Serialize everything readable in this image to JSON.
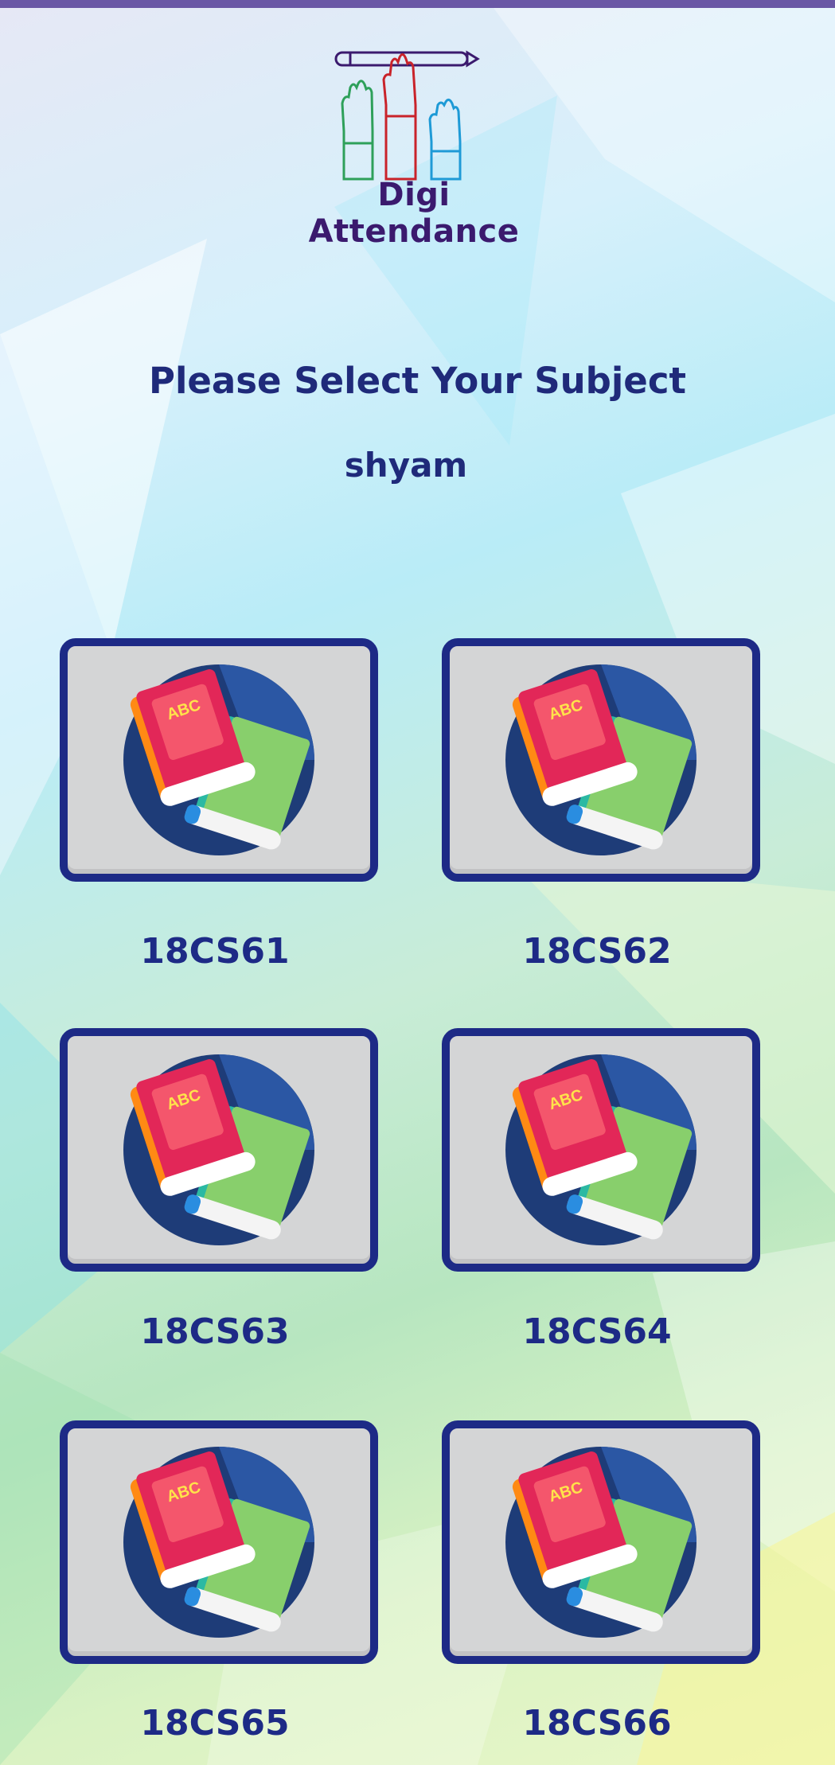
{
  "app": {
    "name": "Digi Attendance"
  },
  "page": {
    "heading": "Please Select Your Subject",
    "user": "shyam"
  },
  "subjects": [
    {
      "code": "18CS61",
      "icon_label": "ABC"
    },
    {
      "code": "18CS62",
      "icon_label": "ABC"
    },
    {
      "code": "18CS63",
      "icon_label": "ABC"
    },
    {
      "code": "18CS64",
      "icon_label": "ABC"
    },
    {
      "code": "18CS65",
      "icon_label": "ABC"
    },
    {
      "code": "18CS66",
      "icon_label": "ABC"
    }
  ],
  "colors": {
    "accent": "#1d2a86",
    "topbar": "#6a57a5",
    "card_bg": "#d4d5d6"
  },
  "icons": {
    "subject": "books-icon",
    "logo": "raised-hands-pencil-logo"
  }
}
